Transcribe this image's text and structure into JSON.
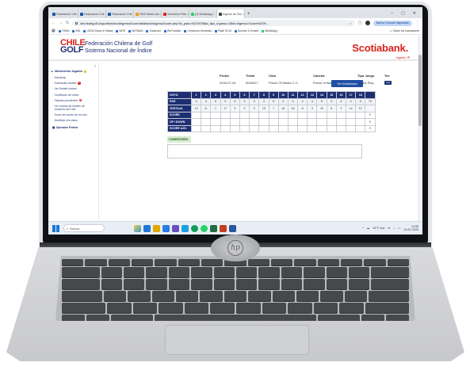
{
  "browser": {
    "tabs": [
      {
        "label": "Federación Chil",
        "active": false
      },
      {
        "label": "Federación Chil",
        "active": false
      },
      {
        "label": "Federación Chil",
        "active": false
      },
      {
        "label": "2025 World Jun",
        "active": false
      },
      {
        "label": "Scheduler Plan",
        "active": false
      },
      {
        "label": "(3) WhatsApp",
        "active": false
      },
      {
        "label": "Ingreso de Sco",
        "active": true
      }
    ],
    "url": "dev.fedegolf.cl/quotitos/modIngresoScore/detallado/ingresoScore.php?id_pais=94729758id_tipo_ingreso=28id=ingreso=Score%20H...",
    "update_label": "Nuevo Chrome disponible",
    "bookmarks": [
      "TOMA",
      "IND",
      "USGA Slope & Rating",
      "WHS",
      "NOTAMA",
      "Traductor",
      "WeTransfer",
      "Conversor Monedas",
      "Flash SCrd",
      "Sunrise & Sunset",
      "WhatsApp"
    ],
    "all_bookmarks_label": "Todos los marcadores"
  },
  "site": {
    "logo_line1": "CHILE",
    "logo_line2": "GOLF",
    "federation_name": "Federación Chilena de Golf",
    "system_name": "Sistema Nacional de Índice",
    "sponsor": "Scotiabank.",
    "player_link": "Jugador ⚙"
  },
  "sidebar": {
    "user": "Movimiento Jugador",
    "items": [
      {
        "label": "Handicap",
        "badge": ""
      },
      {
        "label": "Solicitudes Marker",
        "badge": "5"
      },
      {
        "label": "Ver Detalle Indices",
        "badge": ""
      },
      {
        "label": "Certificado de Indice",
        "badge": ""
      },
      {
        "label": "Tarjetas pendientes",
        "badge": "2"
      },
      {
        "label": "Ver Listado de Indices de Usuarios del Club",
        "badge": ""
      },
      {
        "label": "Score de scores de mi club",
        "badge": ""
      },
      {
        "label": "Modificar mis datos",
        "badge": ""
      }
    ],
    "section": "Operador Federa"
  },
  "round": {
    "headers": {
      "fecha": "Fecha",
      "ticket": "Ticket",
      "club": "Club",
      "cancha": "Cancha",
      "tipo": "Tipo Juego",
      "tee": "Tee"
    },
    "fecha": "2025-07-04",
    "ticket": "5049427",
    "club": "Prince Of Wales C.C.",
    "cancha": "Prince of Wales (VARONES)",
    "tipo": "Stroke Play",
    "tee": "Azul"
  },
  "stats_button": "Ver Estadística",
  "score": {
    "row_labels": {
      "hoyo": "HOYO",
      "par": "PAR",
      "ventaja": "VENTAJA",
      "score": "SCORE",
      "updown": "UP / DOWN",
      "score_ajd": "SCORE AJD."
    },
    "hoyos": [
      "1",
      "2",
      "3",
      "4",
      "5",
      "6",
      "7",
      "8",
      "9",
      "10",
      "11",
      "12",
      "13",
      "14",
      "15",
      "16",
      "17",
      "18"
    ],
    "par": [
      "4",
      "4",
      "5",
      "3",
      "4",
      "4",
      "3",
      "4",
      "5",
      "4",
      "3",
      "4",
      "4",
      "5",
      "3",
      "4",
      "4",
      "5",
      "72"
    ],
    "ventaja": [
      "13",
      "11",
      "1",
      "17",
      "5",
      "3",
      "9",
      "15",
      "7",
      "16",
      "18",
      "8",
      "4",
      "10",
      "6",
      "2",
      "14",
      "12"
    ],
    "score_total": "0",
    "updown_total": "0",
    "score_ajd_total": "0"
  },
  "comment_label": "COMENTARIO",
  "taskbar": {
    "search_label": "Buscar",
    "weather": "19°F Lluv",
    "time": "14:58",
    "date": "04-07-2025"
  }
}
